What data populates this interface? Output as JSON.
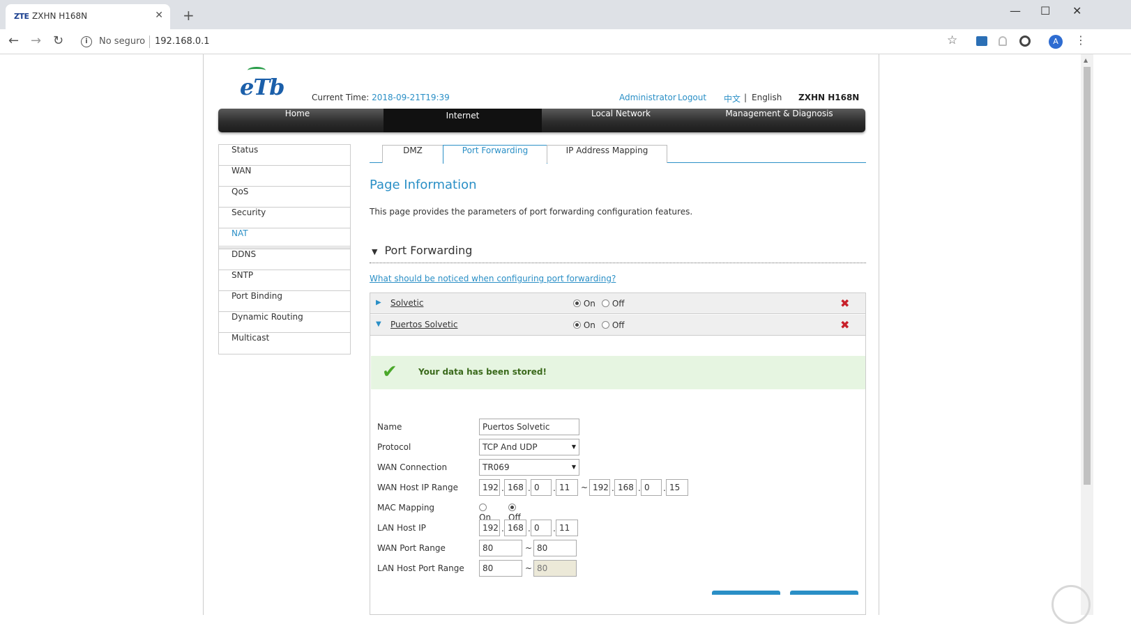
{
  "browser": {
    "tab_favicon": "ZTE",
    "tab_title": "ZXHN H168N",
    "tab_close": "✕",
    "new_tab": "+",
    "win_min": "—",
    "win_max": "☐",
    "win_close": "✕",
    "back": "←",
    "forward": "→",
    "reload": "↻",
    "not_secure": "No seguro",
    "url": "192.168.0.1",
    "star": "☆",
    "avatar": "A",
    "menu": "⋮"
  },
  "header": {
    "logo": "eTb",
    "current_time_label": "Current Time:",
    "current_time_value": "2018-09-21T19:39",
    "admin": "Administrator",
    "logout": "Logout",
    "lang_cn": "中文",
    "lang_sep": "|",
    "lang_en": "English",
    "model": "ZXHN H168N"
  },
  "mainnav": {
    "items": [
      "Home",
      "Internet",
      "Local Network",
      "Management & Diagnosis"
    ],
    "active": "Internet"
  },
  "leftmenu": {
    "items": [
      "Status",
      "WAN",
      "QoS",
      "Security",
      "NAT",
      "DDNS",
      "SNTP",
      "Port Binding",
      "Dynamic Routing",
      "Multicast"
    ],
    "active": "NAT"
  },
  "tabs": {
    "items": [
      "DMZ",
      "Port Forwarding",
      "IP Address Mapping"
    ],
    "active": "Port Forwarding"
  },
  "page": {
    "title": "Page Information",
    "description": "This page provides the parameters of port forwarding configuration features.",
    "section_title": "Port Forwarding",
    "help_link": "What should be noticed when configuring port forwarding?"
  },
  "rules": [
    {
      "name": "Solvetic",
      "on_label": "On",
      "off_label": "Off",
      "state": "On",
      "expanded": false
    },
    {
      "name": "Puertos Solvetic",
      "on_label": "On",
      "off_label": "Off",
      "state": "On",
      "expanded": true
    }
  ],
  "success_message": "Your data has been stored!",
  "form": {
    "name_label": "Name",
    "name_value": "Puertos Solvetic",
    "protocol_label": "Protocol",
    "protocol_value": "TCP And UDP",
    "wan_conn_label": "WAN Connection",
    "wan_conn_value": "TR069",
    "wan_host_ip_label": "WAN Host IP Range",
    "wan_host_ip_start": [
      "192",
      "168",
      "0",
      "11"
    ],
    "wan_host_ip_end": [
      "192",
      "168",
      "0",
      "15"
    ],
    "mac_mapping_label": "MAC Mapping",
    "mac_on": "On",
    "mac_off": "Off",
    "mac_state": "Off",
    "lan_host_ip_label": "LAN Host IP",
    "lan_host_ip": [
      "192",
      "168",
      "0",
      "11"
    ],
    "wan_port_label": "WAN Port Range",
    "wan_port_start": "80",
    "wan_port_end": "80",
    "lan_port_label": "LAN Host Port Range",
    "lan_port_start": "80",
    "lan_port_end": "80",
    "range_sep": "~",
    "ip_sep": "."
  },
  "colors": {
    "accent": "#2a8fc6",
    "delete": "#c8202a",
    "success_bg": "#e6f5e1"
  }
}
